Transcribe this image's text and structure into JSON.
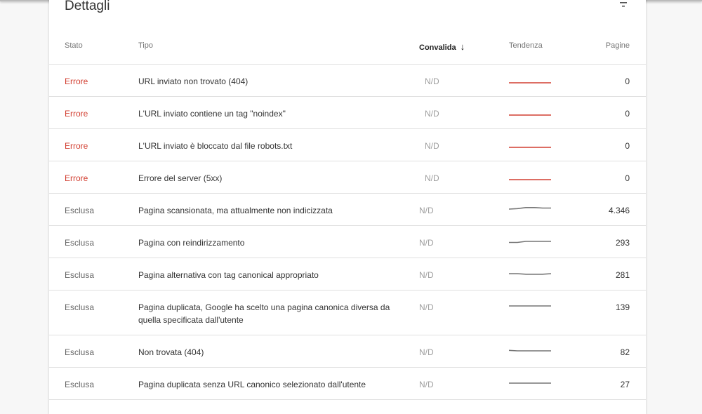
{
  "title": "Dettagli",
  "columns": {
    "stato": "Stato",
    "tipo": "Tipo",
    "convalida": "Convalida",
    "tendenza": "Tendenza",
    "pagine": "Pagine"
  },
  "colors": {
    "error": "#d23f31",
    "trend_error": "#d23f31",
    "trend_excluded": "#757575"
  },
  "rows": [
    {
      "stato": "Errore",
      "kind": "err",
      "tipo": "URL inviato non trovato (404)",
      "convalida": "N/D",
      "pagine": "0",
      "trend": [
        0,
        0,
        0,
        0,
        0,
        0
      ]
    },
    {
      "stato": "Errore",
      "kind": "err",
      "tipo": "L'URL inviato contiene un tag \"noindex\"",
      "convalida": "N/D",
      "pagine": "0",
      "trend": [
        0,
        0,
        0,
        0,
        0,
        0
      ]
    },
    {
      "stato": "Errore",
      "kind": "err",
      "tipo": "L'URL inviato è bloccato dal file robots.txt",
      "convalida": "N/D",
      "pagine": "0",
      "trend": [
        0,
        0,
        0,
        0,
        0,
        0
      ]
    },
    {
      "stato": "Errore",
      "kind": "err",
      "tipo": "Errore del server (5xx)",
      "convalida": "N/D",
      "pagine": "0",
      "trend": [
        0,
        0,
        0,
        0,
        0,
        0
      ]
    },
    {
      "stato": "Esclusa",
      "kind": "exc",
      "tipo": "Pagina scansionata, ma attualmente non indicizzata",
      "convalida": "N/D",
      "pagine": "4.346",
      "trend": [
        4,
        4.5,
        5.5,
        5.5,
        5,
        5
      ]
    },
    {
      "stato": "Esclusa",
      "kind": "exc",
      "tipo": "Pagina con reindirizzamento",
      "convalida": "N/D",
      "pagine": "293",
      "trend": [
        3,
        3,
        4,
        4,
        4,
        4
      ]
    },
    {
      "stato": "Esclusa",
      "kind": "exc",
      "tipo": "Pagina alternativa con tag canonical appropriato",
      "convalida": "N/D",
      "pagine": "281",
      "trend": [
        4,
        4,
        3.5,
        3.5,
        3.5,
        4
      ]
    },
    {
      "stato": "Esclusa",
      "kind": "exc",
      "tipo": "Pagina duplicata, Google ha scelto una pagina canonica diversa da quella specificata dall'utente",
      "convalida": "N/D",
      "pagine": "139",
      "trend": [
        4,
        4,
        4,
        4,
        4,
        4
      ]
    },
    {
      "stato": "Esclusa",
      "kind": "exc",
      "tipo": "Non trovata (404)",
      "convalida": "N/D",
      "pagine": "82",
      "trend": [
        4.5,
        4,
        4,
        4,
        4,
        4
      ]
    },
    {
      "stato": "Esclusa",
      "kind": "exc",
      "tipo": "Pagina duplicata senza URL canonico selezionato dall'utente",
      "convalida": "N/D",
      "pagine": "27",
      "trend": [
        4,
        4,
        4,
        4,
        4,
        4
      ]
    }
  ]
}
